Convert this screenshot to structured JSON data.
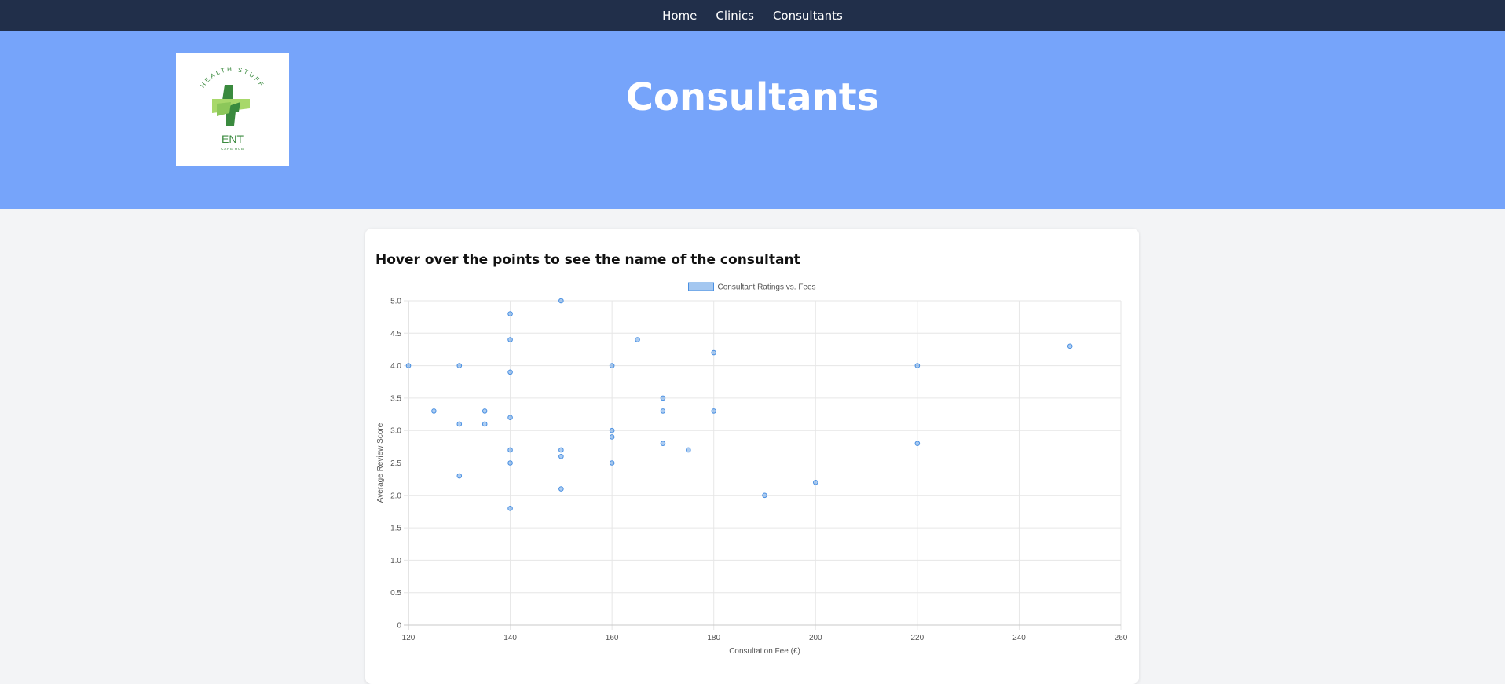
{
  "nav": {
    "items": [
      {
        "label": "Home"
      },
      {
        "label": "Clinics"
      },
      {
        "label": "Consultants"
      }
    ]
  },
  "logo": {
    "arc_text": "HEALTH STUFF",
    "main_text": "ENT",
    "sub_text": "CARE HUB",
    "colors": {
      "dark_green": "#3a8a3e",
      "light_green": "#a8d86a"
    }
  },
  "hero": {
    "title": "Consultants",
    "background": "#76a4fa"
  },
  "card": {
    "heading": "Hover over the points to see the name of the consultant"
  },
  "chart_data": {
    "type": "scatter",
    "legend": "Consultant Ratings vs. Fees",
    "legend_position": "top-center",
    "xlabel": "Consultation Fee (£)",
    "ylabel": "Average Review Score",
    "xlim": [
      120,
      260
    ],
    "ylim": [
      0,
      5
    ],
    "xticks": [
      120,
      140,
      160,
      180,
      200,
      220,
      240,
      260
    ],
    "yticks": [
      0,
      0.5,
      1.0,
      1.5,
      2.0,
      2.5,
      3.0,
      3.5,
      4.0,
      4.5,
      5.0
    ],
    "ytick_labels": [
      "0",
      "0.5",
      "1.0",
      "1.5",
      "2.0",
      "2.5",
      "3.0",
      "3.5",
      "4.0",
      "4.5",
      "5.0"
    ],
    "grid": true,
    "point_color": "#4a90e2",
    "points": [
      {
        "x": 120,
        "y": 4.0
      },
      {
        "x": 125,
        "y": 3.3
      },
      {
        "x": 130,
        "y": 4.0
      },
      {
        "x": 130,
        "y": 3.1
      },
      {
        "x": 130,
        "y": 2.3
      },
      {
        "x": 135,
        "y": 3.3
      },
      {
        "x": 135,
        "y": 3.1
      },
      {
        "x": 140,
        "y": 4.8
      },
      {
        "x": 140,
        "y": 4.4
      },
      {
        "x": 140,
        "y": 3.9
      },
      {
        "x": 140,
        "y": 3.2
      },
      {
        "x": 140,
        "y": 2.7
      },
      {
        "x": 140,
        "y": 2.5
      },
      {
        "x": 140,
        "y": 1.8
      },
      {
        "x": 150,
        "y": 5.0
      },
      {
        "x": 150,
        "y": 2.7
      },
      {
        "x": 150,
        "y": 2.6
      },
      {
        "x": 150,
        "y": 2.1
      },
      {
        "x": 160,
        "y": 4.0
      },
      {
        "x": 160,
        "y": 3.0
      },
      {
        "x": 160,
        "y": 2.9
      },
      {
        "x": 160,
        "y": 2.5
      },
      {
        "x": 165,
        "y": 4.4
      },
      {
        "x": 170,
        "y": 3.5
      },
      {
        "x": 170,
        "y": 3.3
      },
      {
        "x": 170,
        "y": 2.8
      },
      {
        "x": 175,
        "y": 2.7
      },
      {
        "x": 180,
        "y": 4.2
      },
      {
        "x": 180,
        "y": 3.3
      },
      {
        "x": 190,
        "y": 2.0
      },
      {
        "x": 200,
        "y": 2.2
      },
      {
        "x": 220,
        "y": 4.0
      },
      {
        "x": 220,
        "y": 2.8
      },
      {
        "x": 250,
        "y": 4.3
      }
    ]
  }
}
